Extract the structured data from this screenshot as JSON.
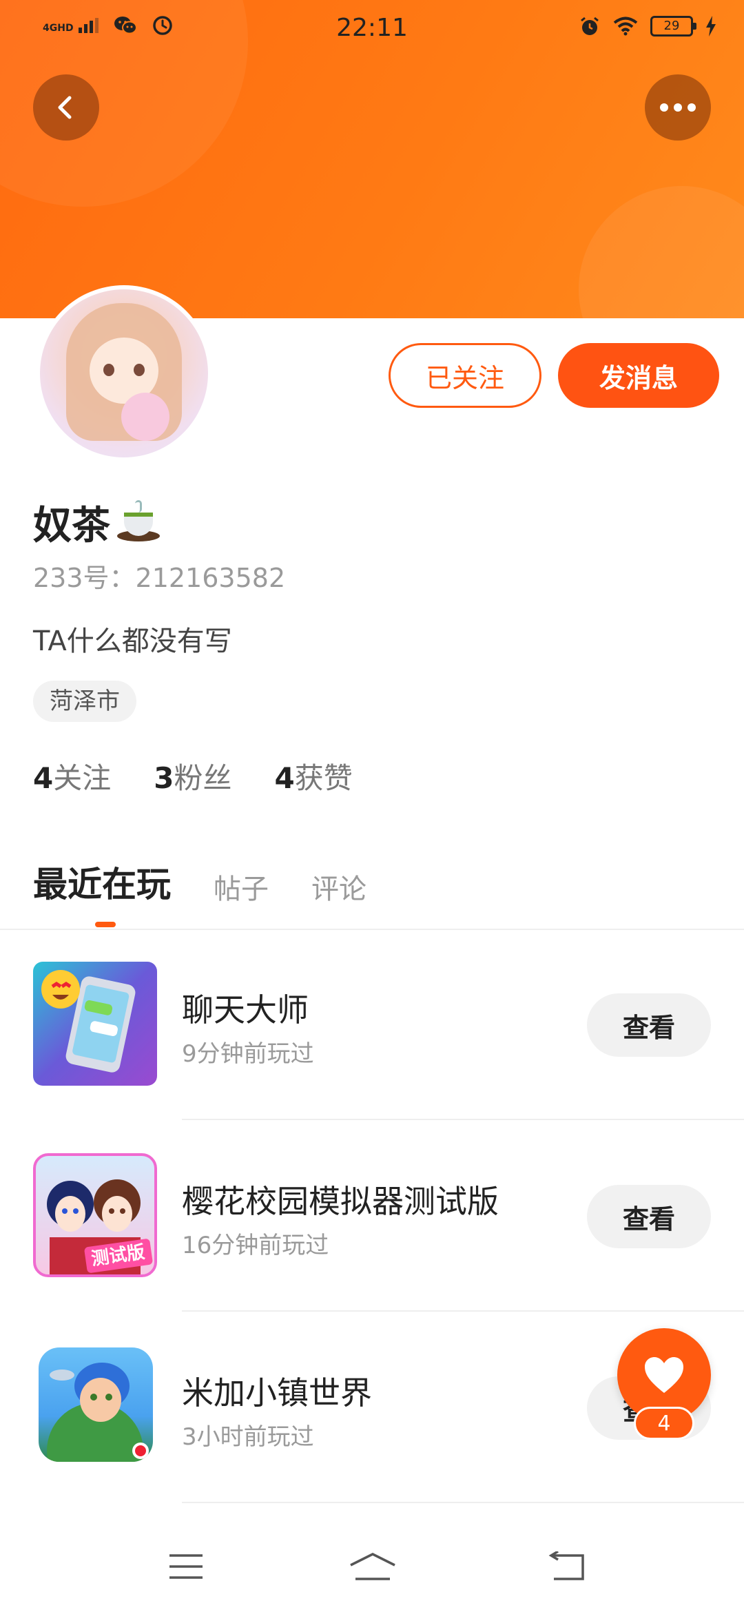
{
  "status_bar": {
    "network": "4GHD",
    "time": "22:11",
    "battery": "29"
  },
  "profile": {
    "name": "奴茶",
    "uid": "233号：212163582",
    "bio": "TA什么都没有写",
    "location": "菏泽市",
    "follow_button": "已关注",
    "message_button": "发消息",
    "stats": {
      "following_num": "4",
      "following_label": "关注",
      "fans_num": "3",
      "fans_label": "粉丝",
      "likes_num": "4",
      "likes_label": "获赞"
    }
  },
  "tabs": [
    "最近在玩",
    "帖子",
    "评论"
  ],
  "games": [
    {
      "title": "聊天大师",
      "sub": "9分钟前玩过",
      "button": "查看"
    },
    {
      "title": "樱花校园模拟器测试版",
      "sub": "16分钟前玩过",
      "button": "查看",
      "badge": "测试版"
    },
    {
      "title": "米加小镇世界",
      "sub": "3小时前玩过",
      "button": "查看"
    }
  ],
  "like_fab": {
    "count": "4"
  },
  "colors": {
    "accent": "#ff5a10",
    "banner": "#ff7a14"
  },
  "icons": [
    "back-arrow-icon",
    "more-dots-icon",
    "wechat-icon",
    "clock-icon",
    "alarm-icon",
    "wifi-icon",
    "charging-icon",
    "tea-emoji-icon",
    "heart-icon",
    "menu-icon",
    "home-icon",
    "back-nav-icon"
  ]
}
